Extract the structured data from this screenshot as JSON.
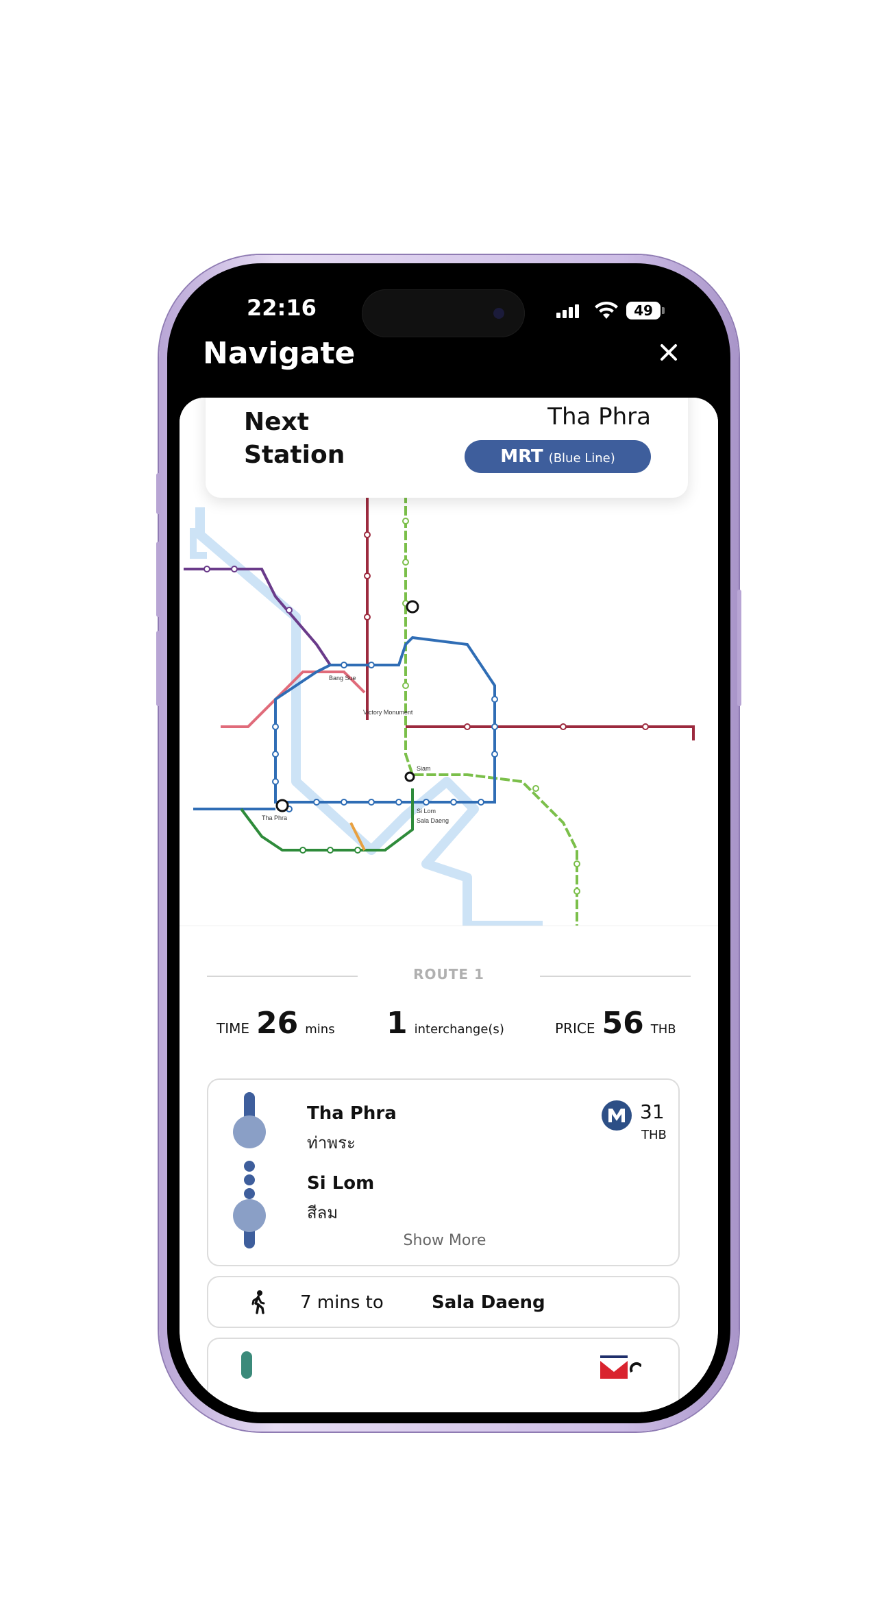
{
  "status_bar": {
    "time": "22:16",
    "battery": "49"
  },
  "header": {
    "title": "Navigate"
  },
  "next_station": {
    "label_line1": "Next",
    "label_line2": "Station",
    "station": "Tha Phra",
    "line": "MRT",
    "line_detail": "(Blue Line)",
    "line_color": "#3e5e9c"
  },
  "route": {
    "title": "ROUTE 1",
    "time_label": "TIME",
    "time_value": "26",
    "time_unit": "mins",
    "interchange_value": "1",
    "interchange_label": "interchange(s)",
    "price_label": "PRICE",
    "price_value": "56",
    "price_unit": "THB"
  },
  "segment": {
    "from_name": "Tha Phra",
    "from_thai": "ท่าพระ",
    "to_name": "Si Lom",
    "to_thai": "สีลม",
    "fare": "31",
    "fare_unit": "THB",
    "show_more": "Show More",
    "line_icon": "mrt-logo-icon"
  },
  "walk": {
    "time": "7 mins to",
    "destination": "Sala Daeng",
    "icon": "walking-person-icon"
  },
  "map": {
    "stations": [
      {
        "label": "Tha Phra"
      },
      {
        "label": "Si Lom"
      },
      {
        "label": "Sala Daeng"
      },
      {
        "label": "Bang Sue"
      },
      {
        "label": "Victory Monument"
      },
      {
        "label": "Siam"
      }
    ]
  }
}
